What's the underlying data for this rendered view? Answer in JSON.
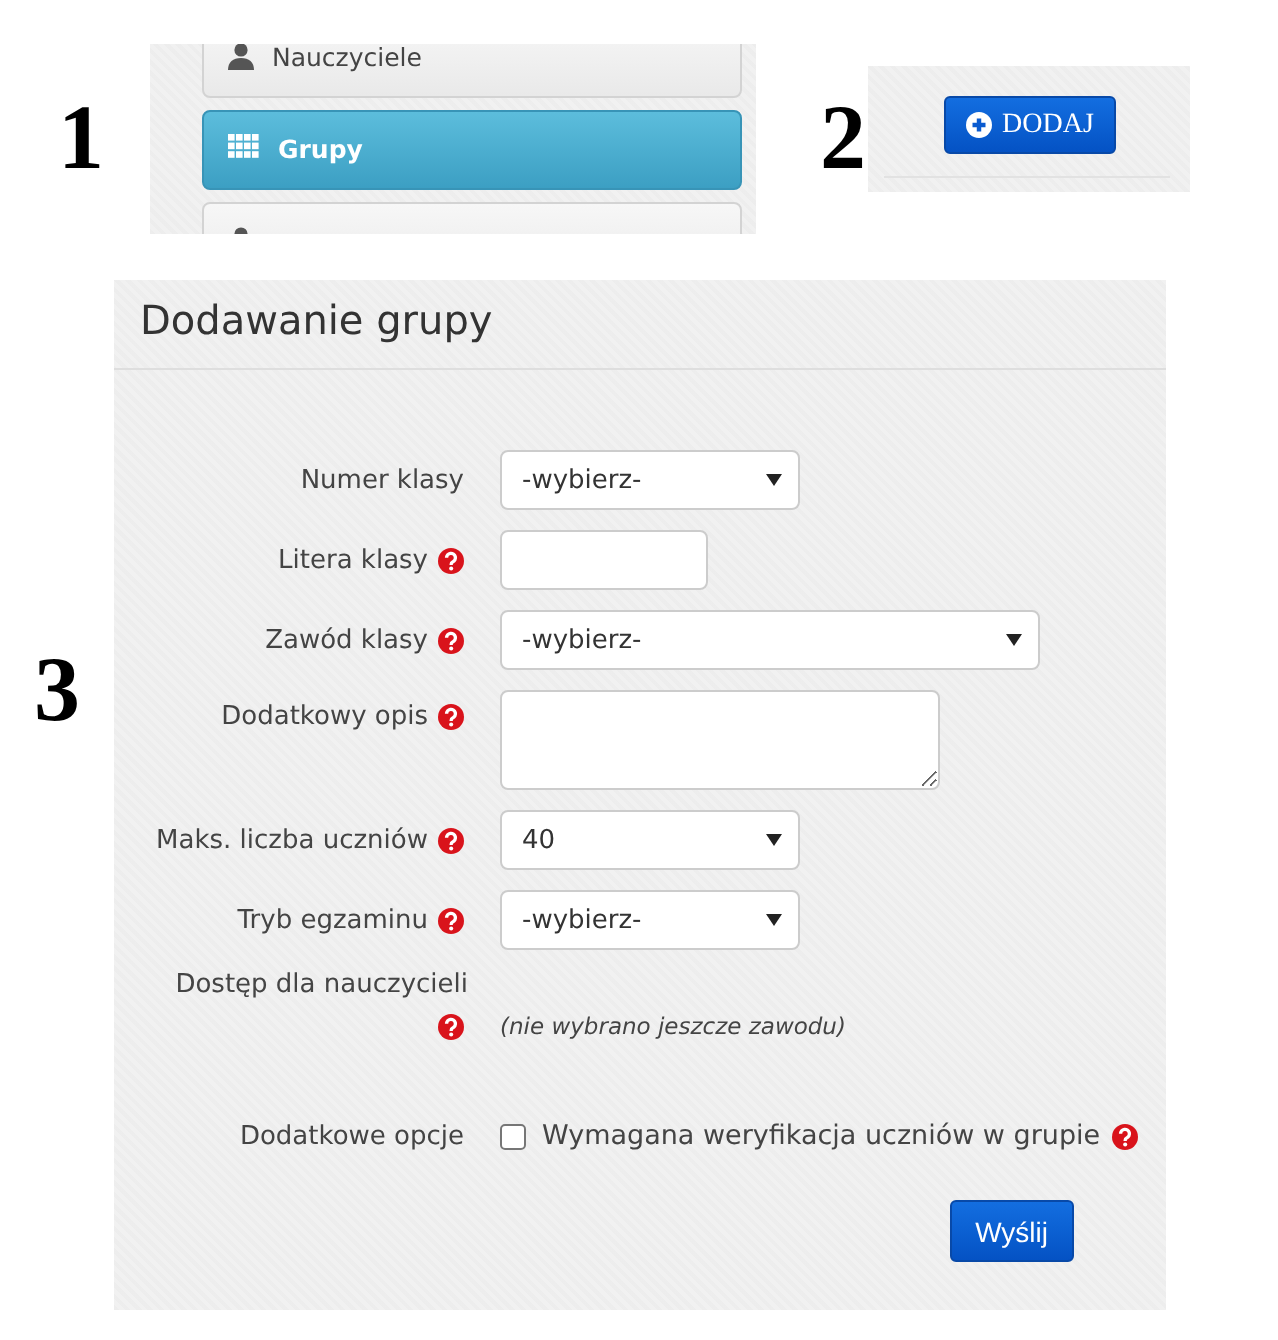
{
  "markers": [
    "1",
    "2",
    "3"
  ],
  "sidebar": {
    "items": [
      {
        "label": "Nauczyciele",
        "kind": "person",
        "selected": false
      },
      {
        "label": "Grupy",
        "kind": "grid",
        "selected": true
      },
      {
        "kind": "person",
        "selected": false
      }
    ]
  },
  "add_button": {
    "label": "DODAJ"
  },
  "form": {
    "title": "Dodawanie grupy",
    "fields": [
      {
        "kind": "select",
        "label": "Numer klasy",
        "help": false,
        "value": "-wybierz-"
      },
      {
        "kind": "text",
        "label": "Litera klasy",
        "help": true
      },
      {
        "kind": "select",
        "label": "Zawód klasy",
        "help": true,
        "value": "-wybierz-"
      },
      {
        "kind": "textarea",
        "label": "Dodatkowy opis",
        "help": true
      },
      {
        "kind": "select",
        "label": "Maks. liczba uczniów",
        "help": true,
        "value": "40"
      },
      {
        "kind": "select",
        "label": "Tryb egzaminu",
        "help": true,
        "value": "-wybierz-"
      },
      {
        "kind": "note",
        "label": "Dostęp dla nauczycieli",
        "help": true,
        "value": "(nie wybrano jeszcze zawodu)"
      },
      {
        "kind": "checkbox",
        "label": "Dodatkowe opcje",
        "help": false,
        "option": "Wymagana weryfikacja uczniów w grupie",
        "option_help": true,
        "checked": false
      }
    ],
    "submit": "Wyślij"
  }
}
